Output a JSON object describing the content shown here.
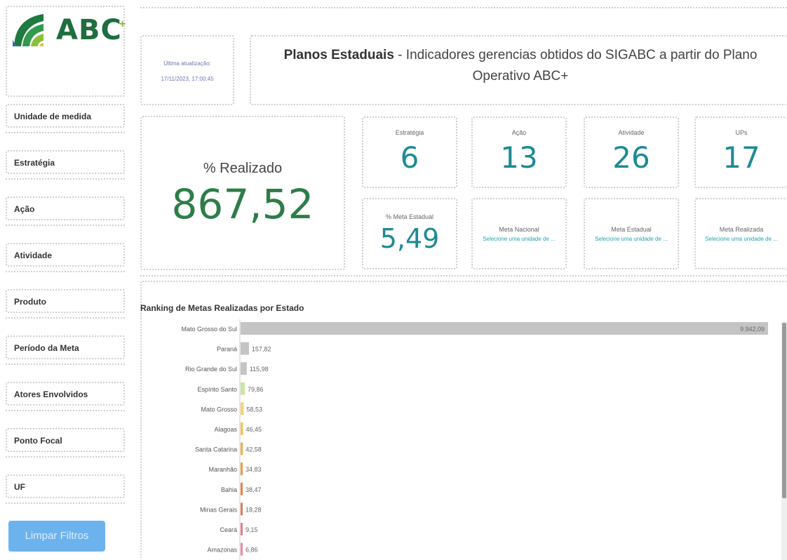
{
  "sidebar": {
    "logo_text": "ABC",
    "logo_plus": "+",
    "filters": [
      {
        "label": "Unidade de medida"
      },
      {
        "label": "Estratégia"
      },
      {
        "label": "Ação"
      },
      {
        "label": "Atividade"
      },
      {
        "label": "Produto"
      },
      {
        "label": "Período da Meta"
      },
      {
        "label": "Atores Envolvidos"
      },
      {
        "label": "Ponto Focal"
      },
      {
        "label": "UF"
      }
    ],
    "clear_button": "Limpar Filtros"
  },
  "header": {
    "update_label": "Última atualização:",
    "update_value": "17/11/2023, 17:00:45",
    "title_bold": "Planos Estaduais",
    "title_rest": " - Indicadores gerencias obtidos do SIGABC a partir do Plano Operativo ABC+"
  },
  "kpis": {
    "realizado": {
      "label": "% Realizado",
      "value": "867,52"
    },
    "estrategia": {
      "label": "Estratégia",
      "value": "6"
    },
    "acao": {
      "label": "Ação",
      "value": "13"
    },
    "atividade": {
      "label": "Atividade",
      "value": "26"
    },
    "ups": {
      "label": "UPs",
      "value": "17"
    },
    "meta_estadual_pct": {
      "label": "% Meta Estadual",
      "value": "5,49"
    },
    "meta_nacional": {
      "label": "Meta Nacional",
      "value": "Selecione uma unidade de ..."
    },
    "meta_estadual": {
      "label": "Meta Estadual",
      "value": "Selecione uma unidade de ..."
    },
    "meta_realizada": {
      "label": "Meta Realizada",
      "value": "Selecione uma unidade de ..."
    }
  },
  "colors": {
    "green_dark": "#2e7d48",
    "teal": "#1f8a94",
    "link": "#1fa3b3",
    "button": "#6cb3ee"
  },
  "chart_data": {
    "type": "bar",
    "orientation": "horizontal",
    "title": "Ranking de Metas Realizadas por Estado",
    "categories": [
      "Mato Grosso do Sul",
      "Paraná",
      "Rio Grande do Sul",
      "Espírito Santo",
      "Mato Grosso",
      "Alagoas",
      "Santa Catarina",
      "Maranhão",
      "Bahia",
      "Minas Gerais",
      "Ceará",
      "Amazonas"
    ],
    "values": [
      9942.09,
      157.82,
      115.98,
      79.86,
      58.53,
      46.45,
      42.58,
      34.83,
      38.47,
      18.28,
      9.15,
      6.86
    ],
    "labels": [
      "9.942,09",
      "157,82",
      "115,98",
      "79,86",
      "58,53",
      "46,45",
      "42,58",
      "34,83",
      "38,47",
      "18,28",
      "9,15",
      "6,86"
    ],
    "bar_colors": [
      "#c4c4c4",
      "#c4c4c4",
      "#c4c4c4",
      "#cde6a8",
      "#f3d27a",
      "#f3c25a",
      "#f0b04c",
      "#ef9a46",
      "#e98446",
      "#e47a5a",
      "#e77f8a",
      "#e88aa0"
    ],
    "xlim": [
      0,
      9942.09
    ],
    "grid": false
  }
}
